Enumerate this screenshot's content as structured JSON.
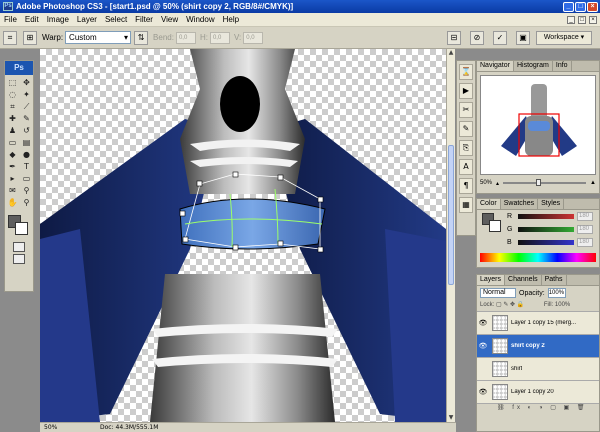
{
  "titlebar": {
    "app_title": "Adobe Photoshop CS3 - [start1.psd @ 50% (shirt copy 2, RGB/8#/CMYK)]",
    "app_icon": "Ps"
  },
  "menu": [
    "File",
    "Edit",
    "Image",
    "Layer",
    "Select",
    "Filter",
    "View",
    "Window",
    "Help"
  ],
  "options": {
    "warp_label": "Warp:",
    "warp_value": "Custom",
    "bend_label": "Bend:",
    "bend_value": "0,0",
    "h_label": "H:",
    "h_value": "0,0",
    "v_label": "V:",
    "v_value": "0,0",
    "workspace_label": "Workspace ▾"
  },
  "toolbox": {
    "logo": "Ps"
  },
  "navigator": {
    "tabs": [
      "Navigator",
      "Histogram",
      "Info"
    ],
    "zoom": "50%"
  },
  "color": {
    "tabs": [
      "Color",
      "Swatches",
      "Styles"
    ],
    "channels": [
      {
        "label": "R",
        "value": "180",
        "color": "#c33"
      },
      {
        "label": "G",
        "value": "180",
        "color": "#3a3"
      },
      {
        "label": "B",
        "value": "180",
        "color": "#33c"
      }
    ]
  },
  "layers": {
    "tabs": [
      "Layers",
      "Channels",
      "Paths"
    ],
    "blend_mode": "Normal",
    "opacity_label": "Opacity:",
    "opacity_value": "100%",
    "lock_label": "Lock:",
    "fill_label": "Fill:",
    "fill_value": "100%",
    "items": [
      {
        "name": "Layer 1 copy 15 (merg...",
        "visible": true,
        "active": false
      },
      {
        "name": "shirt copy 2",
        "visible": true,
        "active": true
      },
      {
        "name": "shirt",
        "visible": false,
        "active": false
      },
      {
        "name": "Layer 1 copy 20",
        "visible": true,
        "active": false
      }
    ]
  },
  "status": {
    "zoom": "50%",
    "doc": "Doc: 44.3M/555.1M"
  }
}
